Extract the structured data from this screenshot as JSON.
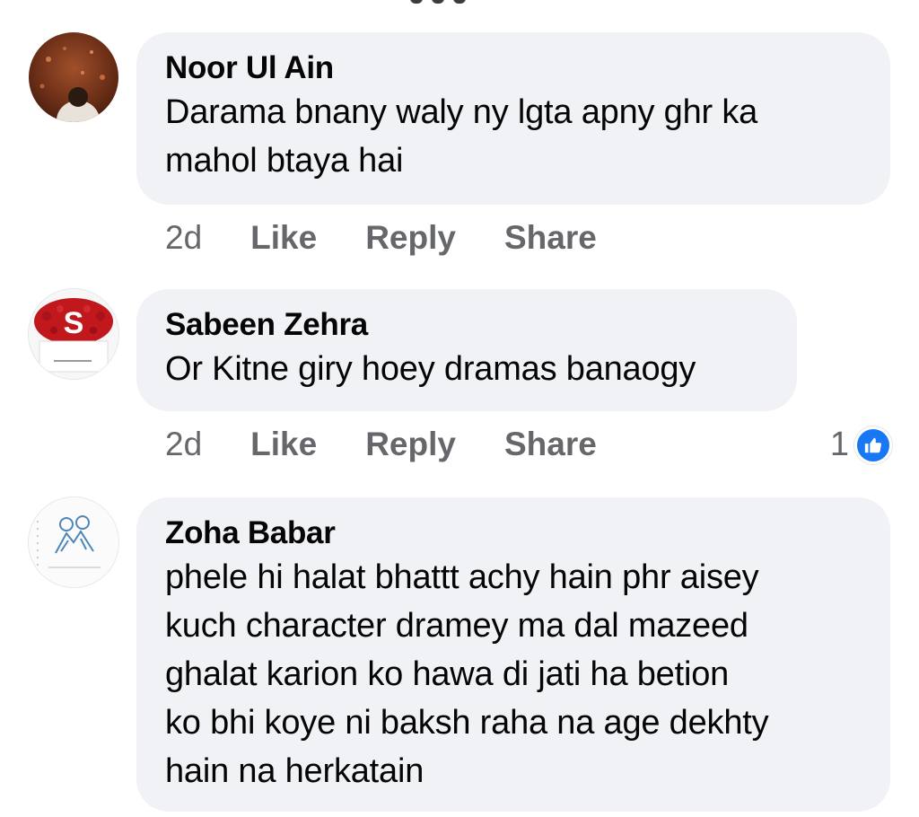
{
  "comments": [
    {
      "author": "Noor Ul Ain",
      "text_lines": [
        "Darama bnany waly ny lgta apny ghr ka",
        "mahol btaya hai"
      ],
      "time": "2d",
      "like_label": "Like",
      "reply_label": "Reply",
      "share_label": "Share",
      "avatar": "photo-person-avatar"
    },
    {
      "author": "Sabeen Zehra",
      "text_lines": [
        "Or Kitne giry hoey dramas banaogy"
      ],
      "time": "2d",
      "like_label": "Like",
      "reply_label": "Reply",
      "share_label": "Share",
      "reaction_count": "1",
      "reaction_icon": "thumbs-up-icon",
      "avatar": "letter-s-flowers-avatar",
      "avatar_letter": "S"
    },
    {
      "author": "Zoha Babar",
      "text_lines": [
        "phele hi halat bhattt achy hain phr aisey",
        "kuch character dramey ma dal mazeed",
        "ghalat karion ko hawa di jati ha betion",
        "ko bhi koye ni baksh raha na age dekhty",
        "hain na herkatain"
      ],
      "avatar": "sketch-drawing-avatar"
    }
  ],
  "colors": {
    "bubble_bg": "#f0f2f5",
    "meta_text": "#65676b",
    "like_blue": "#1877f2"
  }
}
